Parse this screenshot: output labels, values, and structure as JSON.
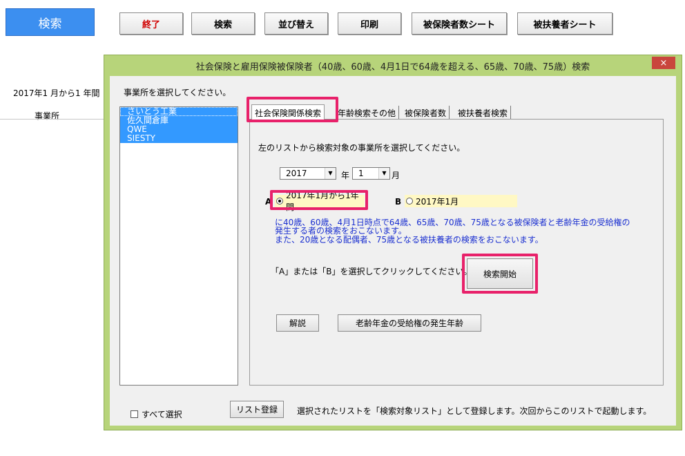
{
  "sheet": {
    "search_button": "検索",
    "buttons": {
      "exit": "終了",
      "search": "検索",
      "sort": "並び替え",
      "print": "印刷",
      "insured_sheet": "被保険者数シート",
      "dependent_sheet": "被扶養者シート"
    },
    "cell_period": "2017年1 月から1 年間",
    "cell_office": "事業所"
  },
  "dialog": {
    "title": "社会保険と雇用保険被保険者（40歳、60歳、4月1日で64歳を超える、65歳、70歳、75歳）検索",
    "close": "×",
    "office_prompt": "事業所を選択してください。",
    "offices": [
      "さいとう工業",
      "佐久間倉庫",
      "QWE",
      "SIESTY"
    ],
    "tabs": [
      "社会保険関係検索",
      "年齢検索その他",
      "被保険者数",
      "被扶養者検索"
    ],
    "panel": {
      "instruction": "左のリストから検索対象の事業所を選択してください。",
      "year_value": "2017",
      "year_label": "年",
      "month_value": "1",
      "month_label": "月",
      "option_a_label": "A",
      "option_a_text": "2017年1月から1年間",
      "option_b_label": "B",
      "option_b_text": "2017年1月",
      "info_line1": "に40歳、60歳、4月1日時点で64歳、65歳、70歳、75歳となる被保険者と老齢年金の受給権の",
      "info_line2": "発生する者の検索をおこないます。",
      "info_line3": "また、20歳となる配偶者、75歳となる被扶養者の検索をおこないます。",
      "select_prompt": "「A」または「B」を選択してクリックしてください。",
      "start_button": "検索開始",
      "explain_button": "解説",
      "pension_button": "老齢年金の受給権の発生年齢"
    },
    "select_all_label": "すべて選択",
    "register_button": "リスト登録",
    "register_note": "選択されたリストを「検索対象リスト」として登録します。次回からこのリストで起動します。"
  },
  "colors": {
    "dialog_frame": "#b7d47a",
    "highlight": "#e8216a",
    "selection": "#3399ff",
    "info_text": "#1a2fd0",
    "exit_text": "#d00000"
  }
}
